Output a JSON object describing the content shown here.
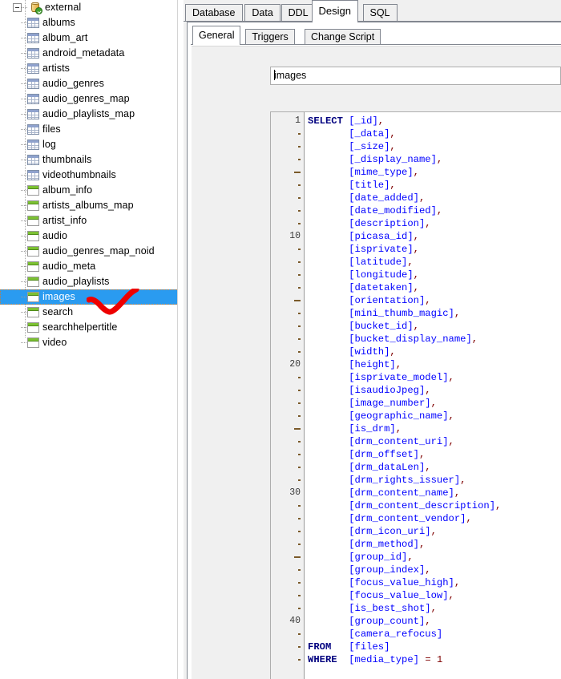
{
  "tree": {
    "root": {
      "label": "external",
      "icon": "database-icon",
      "expanded": true,
      "badge": "green-check-icon"
    },
    "selected": "images",
    "items": [
      {
        "label": "albums",
        "type": "table"
      },
      {
        "label": "album_art",
        "type": "table"
      },
      {
        "label": "android_metadata",
        "type": "table"
      },
      {
        "label": "artists",
        "type": "table"
      },
      {
        "label": "audio_genres",
        "type": "table"
      },
      {
        "label": "audio_genres_map",
        "type": "table"
      },
      {
        "label": "audio_playlists_map",
        "type": "table"
      },
      {
        "label": "files",
        "type": "table"
      },
      {
        "label": "log",
        "type": "table"
      },
      {
        "label": "thumbnails",
        "type": "table"
      },
      {
        "label": "videothumbnails",
        "type": "table"
      },
      {
        "label": "album_info",
        "type": "view"
      },
      {
        "label": "artists_albums_map",
        "type": "view"
      },
      {
        "label": "artist_info",
        "type": "view"
      },
      {
        "label": "audio",
        "type": "view"
      },
      {
        "label": "audio_genres_map_noid",
        "type": "view"
      },
      {
        "label": "audio_meta",
        "type": "view"
      },
      {
        "label": "audio_playlists",
        "type": "view"
      },
      {
        "label": "images",
        "type": "view"
      },
      {
        "label": "search",
        "type": "view"
      },
      {
        "label": "searchhelpertitle",
        "type": "view"
      },
      {
        "label": "video",
        "type": "view"
      }
    ]
  },
  "annotation": {
    "kind": "red-check-mark",
    "color": "#ee0000"
  },
  "tabs": {
    "main": [
      {
        "label": "Database",
        "active": false
      },
      {
        "label": "Data",
        "active": false
      },
      {
        "label": "DDL",
        "active": false
      },
      {
        "label": "Design",
        "active": true
      },
      {
        "label": "SQL",
        "active": false
      }
    ],
    "sub": [
      {
        "label": "General",
        "active": true
      },
      {
        "label": "Triggers",
        "active": false
      },
      {
        "label": "Change Script",
        "active": false
      }
    ]
  },
  "general": {
    "name_value": "images"
  },
  "editor": {
    "total_lines": 43,
    "lines": [
      {
        "n": 1,
        "kw": "SELECT",
        "ident": "[_id]",
        "tail": ","
      },
      {
        "n": 2,
        "kw": "",
        "ident": "[_data]",
        "tail": ","
      },
      {
        "n": 3,
        "kw": "",
        "ident": "[_size]",
        "tail": ","
      },
      {
        "n": 4,
        "kw": "",
        "ident": "[_display_name]",
        "tail": ","
      },
      {
        "n": 5,
        "kw": "",
        "ident": "[mime_type]",
        "tail": ","
      },
      {
        "n": 6,
        "kw": "",
        "ident": "[title]",
        "tail": ","
      },
      {
        "n": 7,
        "kw": "",
        "ident": "[date_added]",
        "tail": ","
      },
      {
        "n": 8,
        "kw": "",
        "ident": "[date_modified]",
        "tail": ","
      },
      {
        "n": 9,
        "kw": "",
        "ident": "[description]",
        "tail": ","
      },
      {
        "n": 10,
        "kw": "",
        "ident": "[picasa_id]",
        "tail": ","
      },
      {
        "n": 11,
        "kw": "",
        "ident": "[isprivate]",
        "tail": ","
      },
      {
        "n": 12,
        "kw": "",
        "ident": "[latitude]",
        "tail": ","
      },
      {
        "n": 13,
        "kw": "",
        "ident": "[longitude]",
        "tail": ","
      },
      {
        "n": 14,
        "kw": "",
        "ident": "[datetaken]",
        "tail": ","
      },
      {
        "n": 15,
        "kw": "",
        "ident": "[orientation]",
        "tail": ","
      },
      {
        "n": 16,
        "kw": "",
        "ident": "[mini_thumb_magic]",
        "tail": ","
      },
      {
        "n": 17,
        "kw": "",
        "ident": "[bucket_id]",
        "tail": ","
      },
      {
        "n": 18,
        "kw": "",
        "ident": "[bucket_display_name]",
        "tail": ","
      },
      {
        "n": 19,
        "kw": "",
        "ident": "[width]",
        "tail": ","
      },
      {
        "n": 20,
        "kw": "",
        "ident": "[height]",
        "tail": ","
      },
      {
        "n": 21,
        "kw": "",
        "ident": "[isprivate_model]",
        "tail": ","
      },
      {
        "n": 22,
        "kw": "",
        "ident": "[isaudioJpeg]",
        "tail": ","
      },
      {
        "n": 23,
        "kw": "",
        "ident": "[image_number]",
        "tail": ","
      },
      {
        "n": 24,
        "kw": "",
        "ident": "[geographic_name]",
        "tail": ","
      },
      {
        "n": 25,
        "kw": "",
        "ident": "[is_drm]",
        "tail": ","
      },
      {
        "n": 26,
        "kw": "",
        "ident": "[drm_content_uri]",
        "tail": ","
      },
      {
        "n": 27,
        "kw": "",
        "ident": "[drm_offset]",
        "tail": ","
      },
      {
        "n": 28,
        "kw": "",
        "ident": "[drm_dataLen]",
        "tail": ","
      },
      {
        "n": 29,
        "kw": "",
        "ident": "[drm_rights_issuer]",
        "tail": ","
      },
      {
        "n": 30,
        "kw": "",
        "ident": "[drm_content_name]",
        "tail": ","
      },
      {
        "n": 31,
        "kw": "",
        "ident": "[drm_content_description]",
        "tail": ","
      },
      {
        "n": 32,
        "kw": "",
        "ident": "[drm_content_vendor]",
        "tail": ","
      },
      {
        "n": 33,
        "kw": "",
        "ident": "[drm_icon_uri]",
        "tail": ","
      },
      {
        "n": 34,
        "kw": "",
        "ident": "[drm_method]",
        "tail": ","
      },
      {
        "n": 35,
        "kw": "",
        "ident": "[group_id]",
        "tail": ","
      },
      {
        "n": 36,
        "kw": "",
        "ident": "[group_index]",
        "tail": ","
      },
      {
        "n": 37,
        "kw": "",
        "ident": "[focus_value_high]",
        "tail": ","
      },
      {
        "n": 38,
        "kw": "",
        "ident": "[focus_value_low]",
        "tail": ","
      },
      {
        "n": 39,
        "kw": "",
        "ident": "[is_best_shot]",
        "tail": ","
      },
      {
        "n": 40,
        "kw": "",
        "ident": "[group_count]",
        "tail": ","
      },
      {
        "n": 41,
        "kw": "",
        "ident": "[camera_refocus]",
        "tail": ""
      },
      {
        "n": 42,
        "kw": "FROM",
        "ident": "[files]",
        "tail": ""
      },
      {
        "n": 43,
        "kw": "WHERE",
        "ident": "[media_type]",
        "tail": " = 1"
      }
    ]
  },
  "colors": {
    "selection_blue": "#2a9bf0",
    "keyword": "#00007f",
    "identifier": "#0000ff",
    "punctuation": "#7f0000",
    "panel_bg": "#f0f0f0",
    "annotation_red": "#ee0000"
  }
}
